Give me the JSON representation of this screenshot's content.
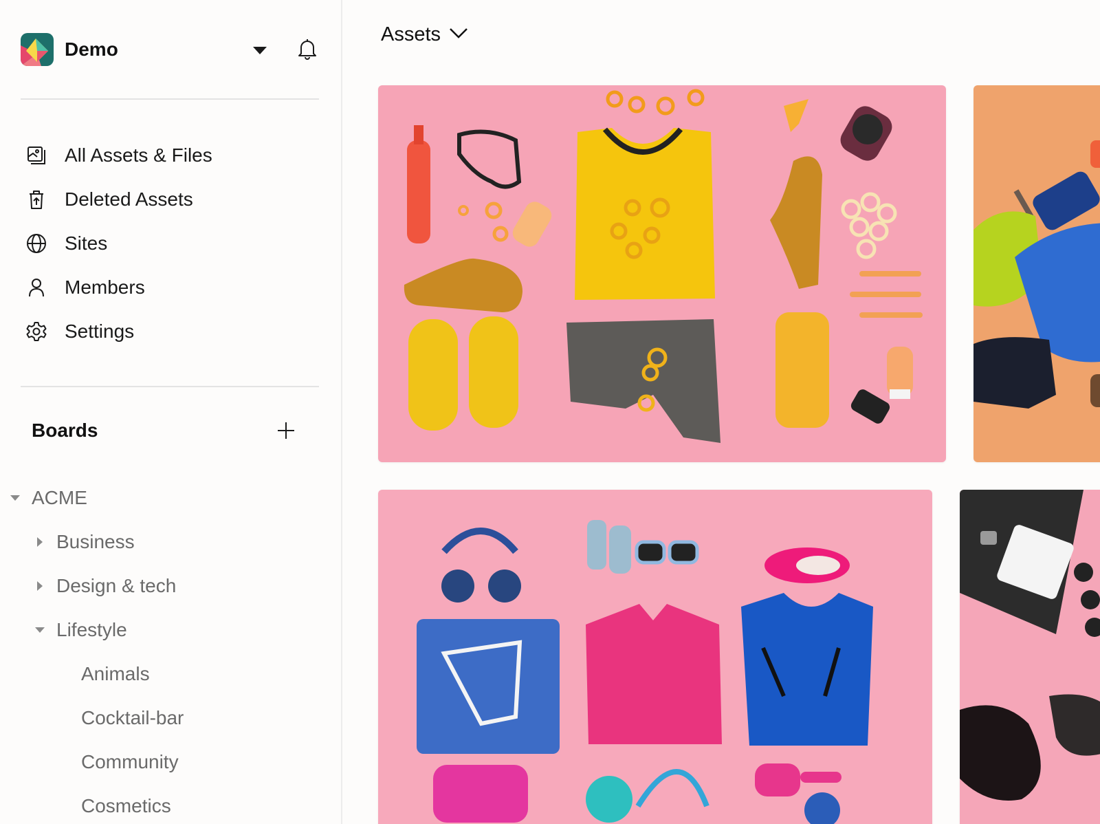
{
  "workspace": {
    "name": "Demo",
    "logo_icon": "workspace-logo",
    "dropdown_icon": "caret-down-icon",
    "notifications_icon": "bell-icon"
  },
  "nav": {
    "items": [
      {
        "label": "All Assets & Files",
        "icon": "assets-files-icon"
      },
      {
        "label": "Deleted Assets",
        "icon": "trash-icon"
      },
      {
        "label": "Sites",
        "icon": "globe-icon"
      },
      {
        "label": "Members",
        "icon": "user-icon"
      },
      {
        "label": "Settings",
        "icon": "gear-icon"
      }
    ]
  },
  "boards": {
    "title": "Boards",
    "add_icon": "plus-icon",
    "tree": [
      {
        "label": "ACME",
        "state": "expanded",
        "level": 0
      },
      {
        "label": "Business",
        "state": "collapsed",
        "level": 1
      },
      {
        "label": "Design & tech",
        "state": "collapsed",
        "level": 1
      },
      {
        "label": "Lifestyle",
        "state": "expanded",
        "level": 1
      },
      {
        "label": "Animals",
        "state": "leaf",
        "level": 2
      },
      {
        "label": "Cocktail-bar",
        "state": "leaf",
        "level": 2
      },
      {
        "label": "Community",
        "state": "leaf",
        "level": 2
      },
      {
        "label": "Cosmetics",
        "state": "leaf",
        "level": 2
      }
    ]
  },
  "main": {
    "title": "Assets",
    "title_icon": "chevron-down-icon"
  },
  "colors": {
    "tile_pink": "#f6a4b6",
    "tile_orange": "#efa36c",
    "tile_pink_2": "#f7a9bb",
    "tile_pink_3": "#f5a6b8"
  }
}
